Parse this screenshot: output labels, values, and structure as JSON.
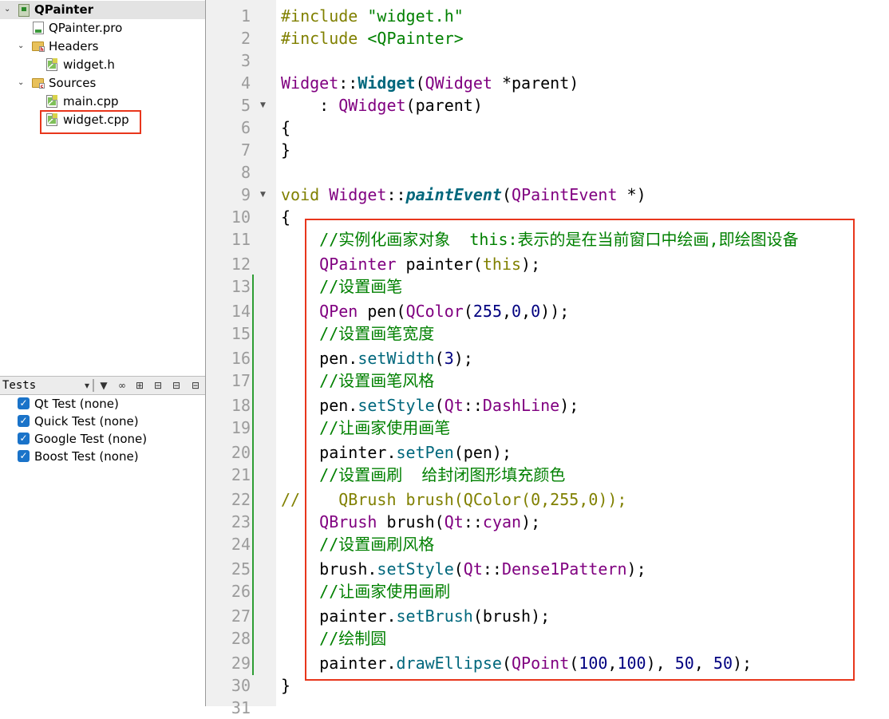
{
  "project_tree": {
    "root": "QPainter",
    "pro_file": "QPainter.pro",
    "headers_folder": "Headers",
    "header_files": [
      "widget.h"
    ],
    "sources_folder": "Sources",
    "source_files": [
      "main.cpp",
      "widget.cpp"
    ]
  },
  "tests_panel": {
    "title": "Tests",
    "items": [
      "Qt Test (none)",
      "Quick Test (none)",
      "Google Test (none)",
      "Boost Test (none)"
    ]
  },
  "editor": {
    "line_numbers": [
      "1",
      "2",
      "3",
      "4",
      "5",
      "6",
      "7",
      "8",
      "9",
      "10",
      "11",
      "12",
      "13",
      "14",
      "15",
      "16",
      "17",
      "18",
      "19",
      "20",
      "21",
      "22",
      "23",
      "24",
      "25",
      "26",
      "27",
      "28",
      "29",
      "30",
      "31"
    ],
    "lines": [
      "#include \"widget.h\"",
      "#include <QPainter>",
      "",
      "Widget::Widget(QWidget *parent)",
      "    : QWidget(parent)",
      "{",
      "}",
      "",
      "void Widget::paintEvent(QPaintEvent *)",
      "{",
      "    //实例化画家对象  this:表示的是在当前窗口中绘画,即绘图设备",
      "    QPainter painter(this);",
      "    //设置画笔",
      "    QPen pen(QColor(255,0,0));",
      "    //设置画笔宽度",
      "    pen.setWidth(3);",
      "    //设置画笔风格",
      "    pen.setStyle(Qt::DashLine);",
      "    //让画家使用画笔",
      "    painter.setPen(pen);",
      "    //设置画刷  给封闭图形填充颜色",
      "//    QBrush brush(QColor(0,255,0));",
      "    QBrush brush(Qt::cyan);",
      "    //设置画刷风格",
      "    brush.setStyle(Qt::Dense1Pattern);",
      "    //让画家使用画刷",
      "    painter.setBrush(brush);",
      "    //绘制圆",
      "    painter.drawEllipse(QPoint(100,100), 50, 50);",
      "}"
    ]
  },
  "colors": {
    "highlight_box": "#e8361c",
    "keyword": "#808000",
    "type": "#800080",
    "string_comment": "#008000",
    "function": "#00677c",
    "number": "#000080",
    "change_bar": "#2e9d34"
  }
}
